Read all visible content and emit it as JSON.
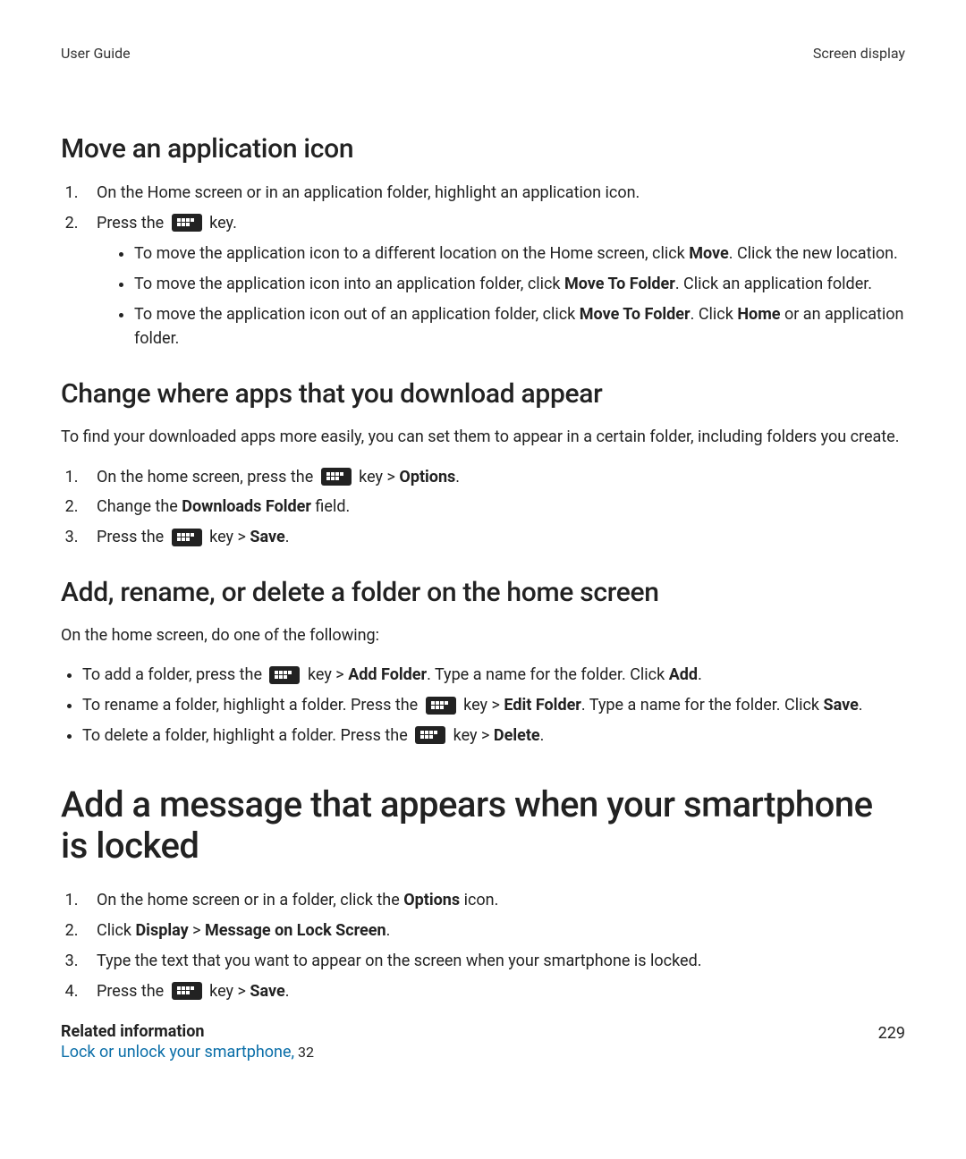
{
  "header": {
    "left": "User Guide",
    "right": "Screen display"
  },
  "s1": {
    "title": "Move an application icon",
    "step1": "On the Home screen or in an application folder, highlight an application icon.",
    "step2_a": "Press the ",
    "step2_b": " key.",
    "b1_a": "To move the application icon to a different location on the Home screen, click ",
    "b1_move": "Move",
    "b1_b": ". Click the new location.",
    "b2_a": "To move the application icon into an application folder, click ",
    "b2_mtf": "Move To Folder",
    "b2_b": ". Click an application folder.",
    "b3_a": "To move the application icon out of an application folder, click ",
    "b3_mtf": "Move To Folder",
    "b3_b": ". Click ",
    "b3_home": "Home",
    "b3_c": " or an application folder."
  },
  "s2": {
    "title": "Change where apps that you download appear",
    "intro": "To find your downloaded apps more easily, you can set them to appear in a certain folder, including folders you create.",
    "st1_a": "On the home screen, press the ",
    "st1_b": " key > ",
    "st1_opt": "Options",
    "st1_c": ".",
    "st2_a": "Change the ",
    "st2_df": "Downloads Folder",
    "st2_b": " field.",
    "st3_a": "Press the ",
    "st3_b": " key > ",
    "st3_save": "Save",
    "st3_c": "."
  },
  "s3": {
    "title": "Add, rename, or delete a folder on the home screen",
    "intro": "On the home screen, do one of the following:",
    "b1_a": "To add a folder, press the ",
    "b1_b": " key > ",
    "b1_af": "Add Folder",
    "b1_c": ". Type a name for the folder. Click ",
    "b1_add": "Add",
    "b1_d": ".",
    "b2_a": "To rename a folder, highlight a folder. Press the ",
    "b2_b": " key > ",
    "b2_ef": "Edit Folder",
    "b2_c": ". Type a name for the folder. Click ",
    "b2_save": "Save",
    "b2_d": ".",
    "b3_a": "To delete a folder, highlight a folder. Press the ",
    "b3_b": " key > ",
    "b3_del": "Delete",
    "b3_c": "."
  },
  "s4": {
    "title": "Add a message that appears when your smartphone is locked",
    "st1_a": "On the home screen or in a folder, click the ",
    "st1_opt": "Options",
    "st1_b": " icon.",
    "st2_a": "Click ",
    "st2_disp": "Display",
    "st2_b": " > ",
    "st2_mls": "Message on Lock Screen",
    "st2_c": ".",
    "st3": "Type the text that you want to appear on the screen when your smartphone is locked.",
    "st4_a": "Press the ",
    "st4_b": " key > ",
    "st4_save": "Save",
    "st4_c": "."
  },
  "related": {
    "head": "Related information",
    "link": "Lock or unlock your smartphone,",
    "page": " 32"
  },
  "pagenum": "229"
}
